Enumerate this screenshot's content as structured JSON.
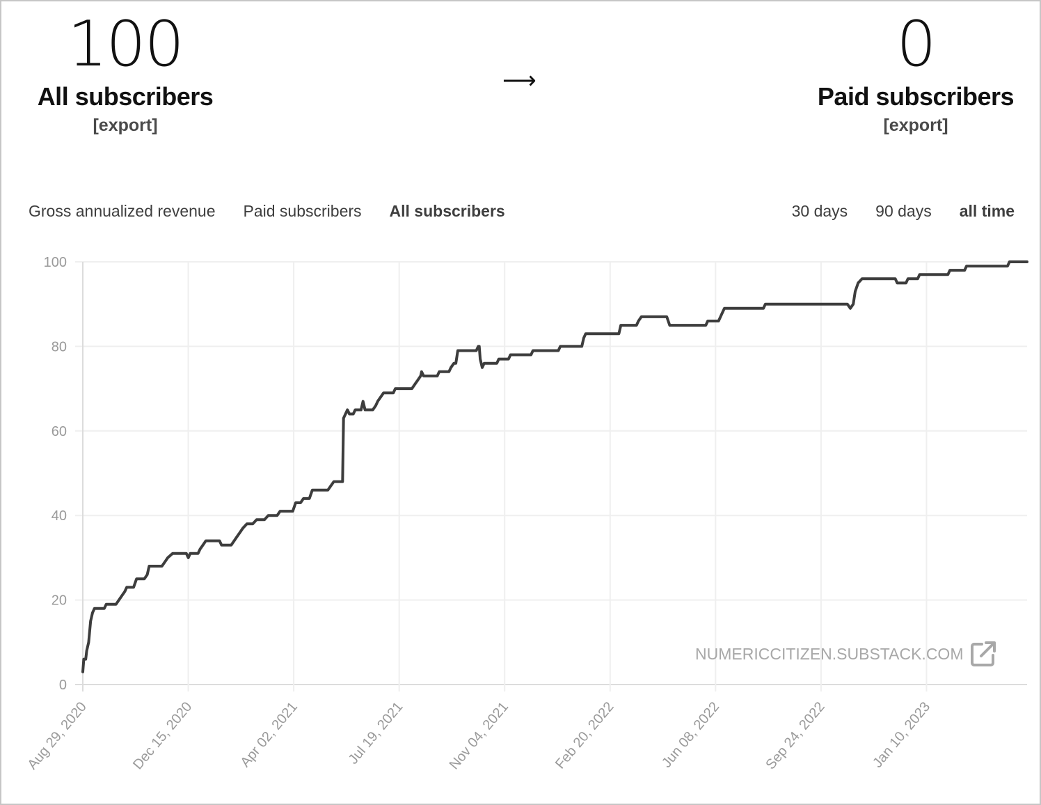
{
  "summary": {
    "left": {
      "value": "100",
      "label": "All subscribers",
      "export_label": "[export]"
    },
    "arrow": "⟶",
    "right": {
      "value": "0",
      "label": "Paid subscribers",
      "export_label": "[export]"
    }
  },
  "metric_tabs": [
    {
      "label": "Gross annualized revenue",
      "active": false
    },
    {
      "label": "Paid subscribers",
      "active": false
    },
    {
      "label": "All subscribers",
      "active": true
    }
  ],
  "range_tabs": [
    {
      "label": "30 days",
      "active": false
    },
    {
      "label": "90 days",
      "active": false
    },
    {
      "label": "all time",
      "active": true
    }
  ],
  "watermark": {
    "text": "NUMERICCITIZEN.SUBSTACK.COM",
    "icon": "external-link-icon"
  },
  "colors": {
    "line": "#3d3d3d",
    "grid": "#efefef",
    "axis": "#dcdcdc",
    "tick_text": "#9a9a9a"
  },
  "chart_data": {
    "type": "line",
    "title": "",
    "xlabel": "",
    "ylabel": "",
    "series_name": "All subscribers",
    "x_unit": "days since Aug 29, 2020",
    "xlim": [
      0,
      967
    ],
    "ylim": [
      0,
      100
    ],
    "yticks": [
      0,
      20,
      40,
      60,
      80,
      100
    ],
    "xtick_labels": [
      "Aug 29, 2020",
      "Dec 15, 2020",
      "Apr 02, 2021",
      "Jul 19, 2021",
      "Nov 04, 2021",
      "Feb 20, 2022",
      "Jun 08, 2022",
      "Sep 24, 2022",
      "Jan 10, 2023"
    ],
    "xtick_days": [
      0,
      108,
      216,
      324,
      432,
      540,
      648,
      756,
      864
    ],
    "grid": true,
    "legend": "none",
    "points": [
      [
        0,
        3
      ],
      [
        1,
        6
      ],
      [
        3,
        6
      ],
      [
        4,
        8
      ],
      [
        6,
        10
      ],
      [
        8,
        15
      ],
      [
        10,
        17
      ],
      [
        12,
        18
      ],
      [
        22,
        18
      ],
      [
        24,
        19
      ],
      [
        34,
        19
      ],
      [
        37,
        20
      ],
      [
        40,
        21
      ],
      [
        43,
        22
      ],
      [
        45,
        23
      ],
      [
        52,
        23
      ],
      [
        55,
        25
      ],
      [
        63,
        25
      ],
      [
        66,
        26
      ],
      [
        68,
        28
      ],
      [
        81,
        28
      ],
      [
        84,
        29
      ],
      [
        87,
        30
      ],
      [
        92,
        31
      ],
      [
        106,
        31
      ],
      [
        108,
        30
      ],
      [
        110,
        31
      ],
      [
        118,
        31
      ],
      [
        120,
        32
      ],
      [
        123,
        33
      ],
      [
        126,
        34
      ],
      [
        140,
        34
      ],
      [
        142,
        33
      ],
      [
        152,
        33
      ],
      [
        155,
        34
      ],
      [
        158,
        35
      ],
      [
        161,
        36
      ],
      [
        164,
        37
      ],
      [
        168,
        38
      ],
      [
        174,
        38
      ],
      [
        178,
        39
      ],
      [
        186,
        39
      ],
      [
        190,
        40
      ],
      [
        199,
        40
      ],
      [
        202,
        41
      ],
      [
        215,
        41
      ],
      [
        218,
        43
      ],
      [
        223,
        43
      ],
      [
        226,
        44
      ],
      [
        232,
        44
      ],
      [
        235,
        46
      ],
      [
        251,
        46
      ],
      [
        254,
        47
      ],
      [
        257,
        48
      ],
      [
        266,
        48
      ],
      [
        267,
        63
      ],
      [
        269,
        64
      ],
      [
        271,
        65
      ],
      [
        273,
        64
      ],
      [
        277,
        64
      ],
      [
        279,
        65
      ],
      [
        285,
        65
      ],
      [
        287,
        67
      ],
      [
        289,
        65
      ],
      [
        297,
        65
      ],
      [
        300,
        66
      ],
      [
        302,
        67
      ],
      [
        305,
        68
      ],
      [
        308,
        69
      ],
      [
        318,
        69
      ],
      [
        320,
        70
      ],
      [
        337,
        70
      ],
      [
        340,
        71
      ],
      [
        343,
        72
      ],
      [
        346,
        73
      ],
      [
        347,
        74
      ],
      [
        349,
        73
      ],
      [
        363,
        73
      ],
      [
        365,
        74
      ],
      [
        375,
        74
      ],
      [
        377,
        75
      ],
      [
        380,
        76
      ],
      [
        382,
        76
      ],
      [
        384,
        79
      ],
      [
        403,
        79
      ],
      [
        405,
        80
      ],
      [
        406,
        80
      ],
      [
        407,
        77
      ],
      [
        409,
        75
      ],
      [
        411,
        76
      ],
      [
        424,
        76
      ],
      [
        426,
        77
      ],
      [
        436,
        77
      ],
      [
        438,
        78
      ],
      [
        459,
        78
      ],
      [
        461,
        79
      ],
      [
        487,
        79
      ],
      [
        489,
        80
      ],
      [
        511,
        80
      ],
      [
        513,
        82
      ],
      [
        515,
        83
      ],
      [
        549,
        83
      ],
      [
        551,
        85
      ],
      [
        567,
        85
      ],
      [
        569,
        86
      ],
      [
        572,
        87
      ],
      [
        598,
        87
      ],
      [
        601,
        85
      ],
      [
        638,
        85
      ],
      [
        640,
        86
      ],
      [
        651,
        86
      ],
      [
        653,
        87
      ],
      [
        655,
        88
      ],
      [
        657,
        89
      ],
      [
        697,
        89
      ],
      [
        699,
        90
      ],
      [
        783,
        90
      ],
      [
        786,
        89
      ],
      [
        789,
        90
      ],
      [
        791,
        93
      ],
      [
        794,
        95
      ],
      [
        798,
        96
      ],
      [
        832,
        96
      ],
      [
        834,
        95
      ],
      [
        843,
        95
      ],
      [
        845,
        96
      ],
      [
        855,
        96
      ],
      [
        857,
        97
      ],
      [
        886,
        97
      ],
      [
        888,
        98
      ],
      [
        903,
        98
      ],
      [
        905,
        99
      ],
      [
        947,
        99
      ],
      [
        949,
        100
      ],
      [
        967,
        100
      ]
    ]
  }
}
